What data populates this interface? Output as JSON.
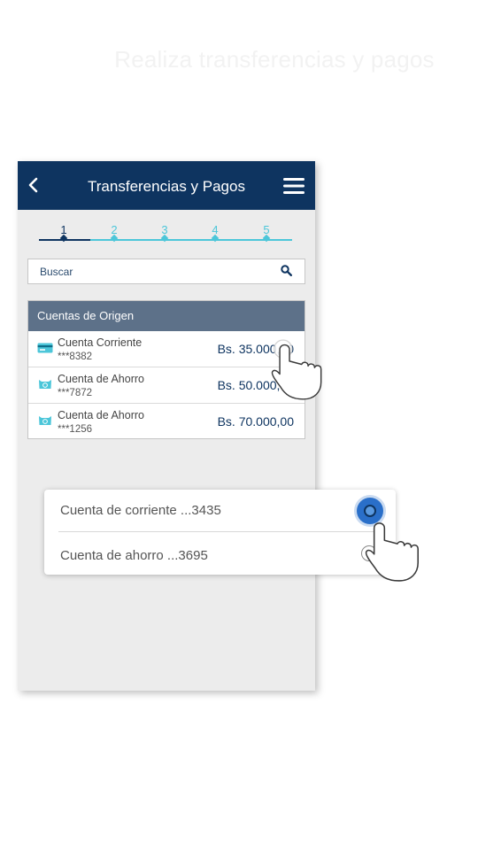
{
  "headline": "Realiza transferencias y pagos",
  "appbar": {
    "title": "Transferencias y Pagos",
    "back_icon": "chevron-left-icon",
    "menu_icon": "hamburger-menu-icon"
  },
  "steps": {
    "items": [
      "1",
      "2",
      "3",
      "4",
      "5"
    ],
    "active_index": 0
  },
  "search": {
    "placeholder": "Buscar",
    "icon": "search-icon"
  },
  "accounts": {
    "header": "Cuentas de Origen",
    "rows": [
      {
        "icon": "credit-card-icon",
        "name": "Cuenta Corriente",
        "number": "***8382",
        "balance": "Bs. 35.000,00"
      },
      {
        "icon": "piggy-bank-icon",
        "name": "Cuenta de Ahorro",
        "number": "***7872",
        "balance": "Bs. 50.000,00"
      },
      {
        "icon": "piggy-bank-icon",
        "name": "Cuenta de Ahorro",
        "number": "***1256",
        "balance": "Bs. 70.000,00"
      }
    ]
  },
  "dropdown": {
    "options": [
      {
        "label": "Cuenta de corriente ...3435",
        "selected": true
      },
      {
        "label": "Cuenta de ahorro ...3695",
        "selected": false
      }
    ]
  },
  "colors": {
    "appbar": "#0e3460",
    "accent": "#4cc6d9",
    "header_bar": "#5d7189",
    "radio_selected": "#2a6fc9"
  }
}
